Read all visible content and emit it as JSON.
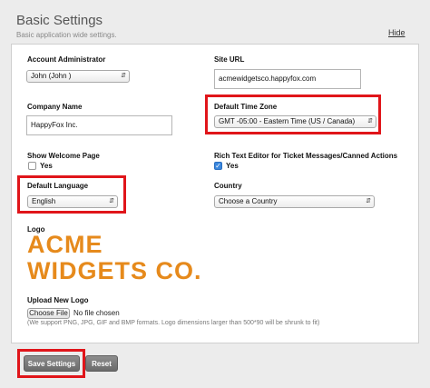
{
  "header": {
    "title": "Basic Settings",
    "subtitle": "Basic application wide settings.",
    "hide_label": "Hide"
  },
  "form": {
    "account_admin": {
      "label": "Account Administrator",
      "value": "John (John )"
    },
    "site_url": {
      "label": "Site URL",
      "value": "acmewidgetsco.happyfox.com"
    },
    "company_name": {
      "label": "Company Name",
      "value": "HappyFox Inc."
    },
    "time_zone": {
      "label": "Default Time Zone",
      "value": "GMT -05:00 - Eastern Time (US / Canada)"
    },
    "welcome_page": {
      "label": "Show Welcome Page",
      "option_label": "Yes",
      "checked": false
    },
    "rich_text": {
      "label": "Rich Text Editor for Ticket Messages/Canned Actions",
      "option_label": "Yes",
      "checked": true
    },
    "language": {
      "label": "Default Language",
      "value": "English"
    },
    "country": {
      "label": "Country",
      "value": "Choose a Country"
    },
    "logo": {
      "label": "Logo",
      "line1": "ACME",
      "line2": "WIDGETS CO.",
      "color": "#e68a1c"
    },
    "upload_logo": {
      "label": "Upload New Logo",
      "button_label": "Choose File",
      "status": "No file chosen",
      "note": "(We support PNG, JPG, GIF and BMP formats. Logo dimensions larger than 500*90 will be shrunk to fit)"
    }
  },
  "actions": {
    "save_label": "Save Settings",
    "reset_label": "Reset"
  },
  "colors": {
    "highlight": "#e0151a",
    "checkbox_checked": "#3b87dd",
    "logo": "#e68a1c"
  }
}
